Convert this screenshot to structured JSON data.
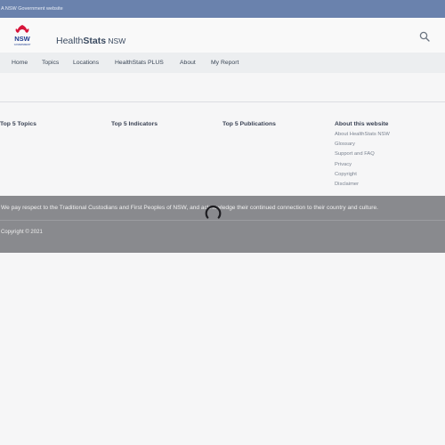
{
  "gov_bar": {
    "text": "A NSW Government website"
  },
  "logo": {
    "text": "NSW",
    "subtext": "GOVERNMENT"
  },
  "brand": {
    "name_light": "Health",
    "name_bold": "Stats",
    "suffix": " NSW"
  },
  "nav": {
    "items": [
      "Home",
      "Topics",
      "Locations",
      "HealthStats PLUS",
      "About",
      "My Report"
    ]
  },
  "footer": {
    "columns": [
      "Top 5 Topics",
      "Top 5 Indicators",
      "Top 5 Publications",
      "About this website"
    ],
    "about_links": [
      "About HealthStats NSW",
      "Glossary",
      "Support and FAQ",
      "Privacy",
      "Copyright",
      "Disclaimer"
    ],
    "acknowledgement": "We pay respect to the Traditional Custodians and First Peoples of NSW, and acknowledge their continued connection to their country and culture.",
    "copyright": "Copyright © 2021"
  },
  "colors": {
    "gov_bar": "#6a82ad",
    "overlay": "#898a8e",
    "logo_red": "#d7153a",
    "logo_blue": "#1d3c8f"
  },
  "icons": {
    "search": "search-icon",
    "spinner": "loading-spinner-icon"
  }
}
